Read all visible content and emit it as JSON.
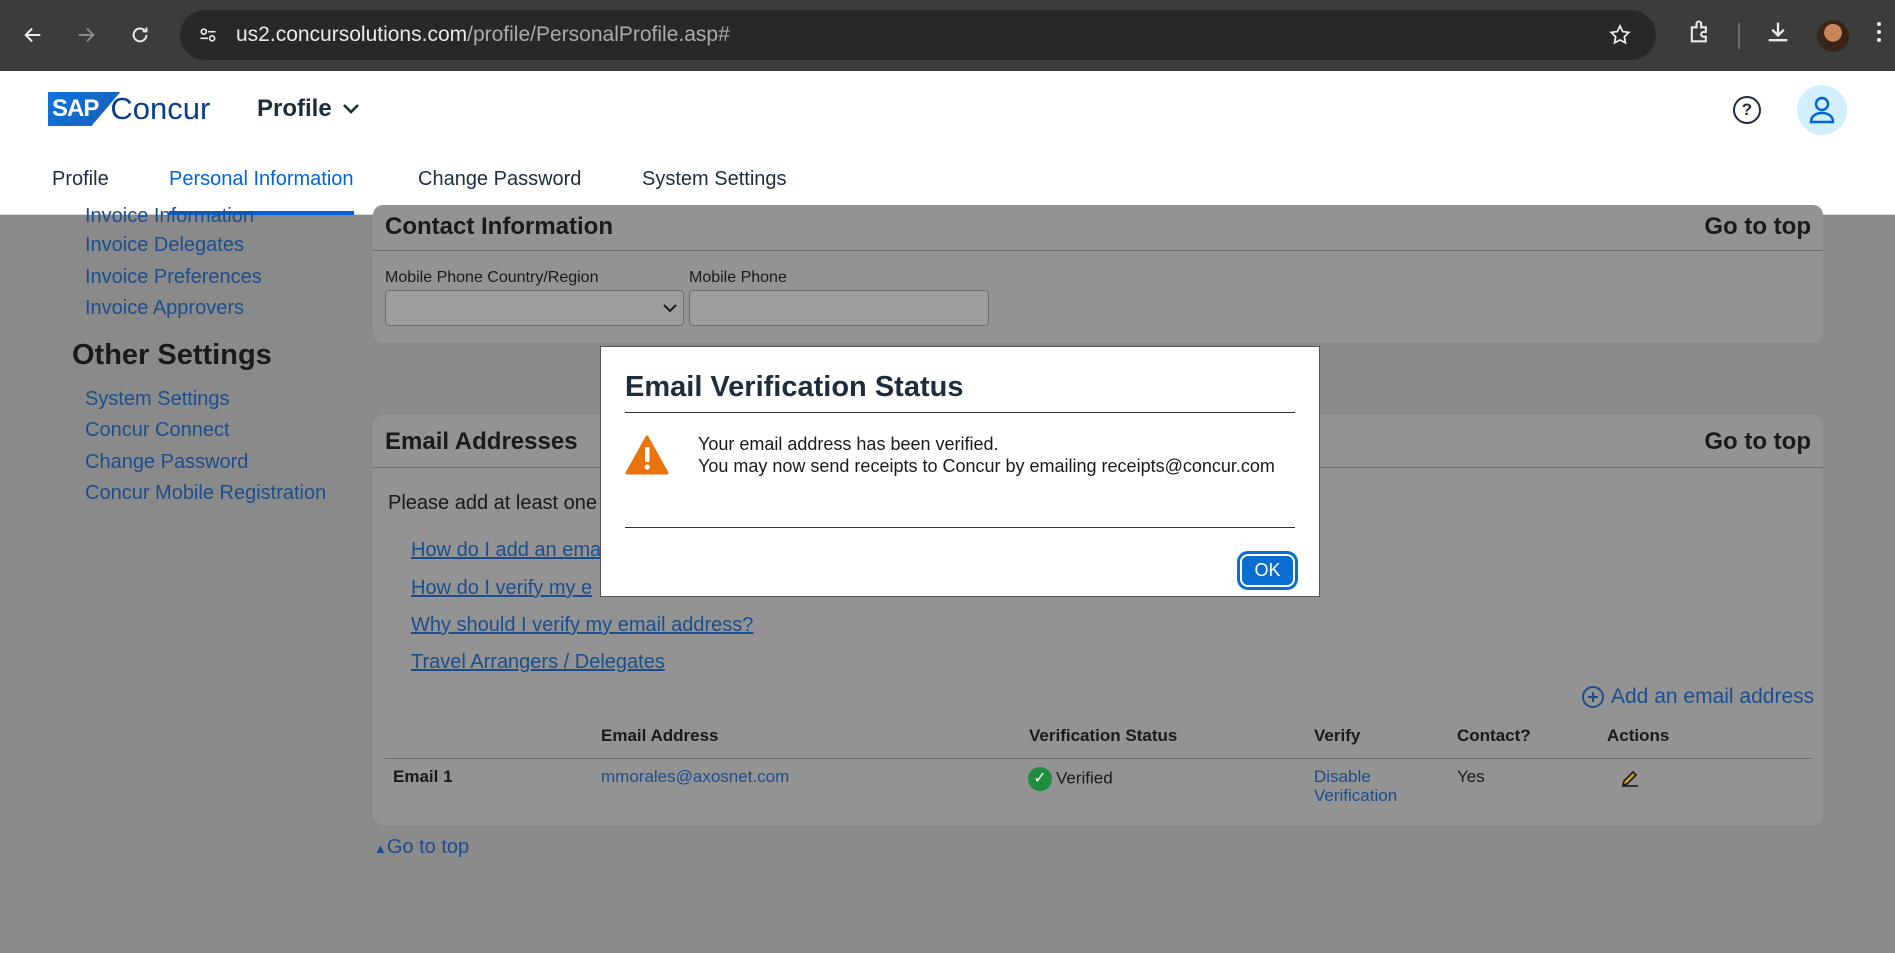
{
  "browser": {
    "url_host": "us2.concursolutions.com",
    "url_path": "/profile/PersonalProfile.asp#"
  },
  "header": {
    "logo_sap": "SAP",
    "logo_concur": "Concur",
    "menu_label": "Profile",
    "tabs": [
      {
        "label": "Profile",
        "active": false
      },
      {
        "label": "Personal Information",
        "active": true
      },
      {
        "label": "Change Password",
        "active": false
      },
      {
        "label": "System Settings",
        "active": false
      }
    ]
  },
  "sidebar": {
    "partial_item": "Invoice Information",
    "items_top": [
      "Invoice Delegates",
      "Invoice Preferences",
      "Invoice Approvers"
    ],
    "other_heading": "Other Settings",
    "items_other": [
      "System Settings",
      "Concur Connect",
      "Change Password",
      "Concur Mobile Registration"
    ]
  },
  "contact_panel": {
    "title": "Contact Information",
    "go_top": "Go to top",
    "country_label": "Mobile Phone Country/Region",
    "phone_label": "Mobile Phone"
  },
  "email_panel": {
    "title": "Email Addresses",
    "go_top": "Go to top",
    "intro": "Please add at least one",
    "links": [
      "How do I add an ema",
      "How do I verify my e",
      "Why should I verify my email address?",
      "Travel Arrangers / Delegates"
    ],
    "add_email": "Add an email address",
    "columns": [
      "Email Address",
      "Verification Status",
      "Verify",
      "Contact?",
      "Actions"
    ],
    "rows": [
      {
        "name": "Email 1",
        "email": "mmorales@axosnet.com",
        "status": "Verified",
        "verify": "Disable Verification",
        "verify_line1": "Disable",
        "verify_line2": "Verification",
        "contact": "Yes"
      }
    ]
  },
  "bottom_go_top": "Go to top",
  "modal": {
    "title": "Email Verification Status",
    "line1": "Your email address has been verified.",
    "line2": "You may now send receipts to Concur by emailing receipts@concur.com",
    "ok": "OK"
  }
}
